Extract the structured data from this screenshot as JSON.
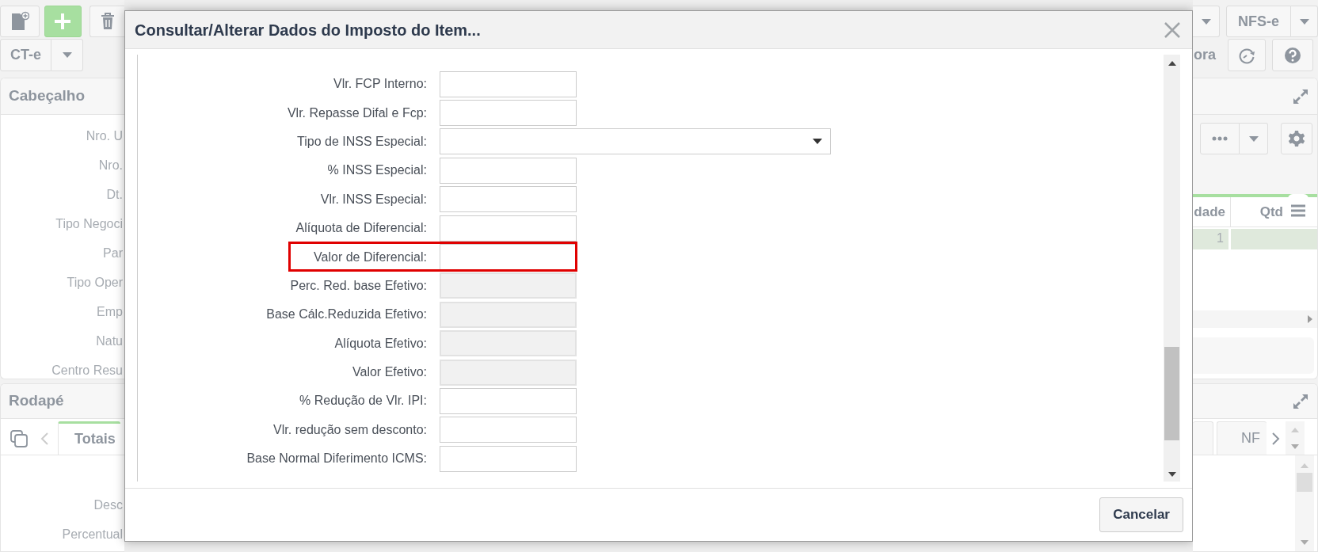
{
  "toolbar": {
    "ct_button": "CT-e",
    "nfse_button": "NFS-e",
    "partial_button": "ora"
  },
  "header_panel": {
    "title": "Cabeçalho",
    "labels": [
      "Nro. U",
      "Nro.",
      "Dt.",
      "Tipo Negoci",
      "Par",
      "Tipo Oper",
      "Emp",
      "Natu",
      "Centro Resu"
    ],
    "table": {
      "columns": [
        "dade",
        "Qtd"
      ],
      "rows": [
        {
          "cells": [
            "1"
          ],
          "selected": true
        }
      ]
    }
  },
  "footer_panel": {
    "title": "Rodapé",
    "tabs": [
      {
        "label": "Totais",
        "selected": true
      },
      {
        "label": "NF",
        "selected": false
      }
    ],
    "labels": [
      "Desc",
      "Percentual"
    ]
  },
  "dialog": {
    "title": "Consultar/Alterar Dados do Imposto do Item...",
    "fields": [
      {
        "label": "Vlr. FCP Interno:",
        "kind": "input",
        "disabled": false,
        "highlighted": false
      },
      {
        "label": "Vlr. Repasse Difal e Fcp:",
        "kind": "input",
        "disabled": false,
        "highlighted": false
      },
      {
        "label": "Tipo de INSS Especial:",
        "kind": "select",
        "disabled": false,
        "highlighted": false
      },
      {
        "label": "% INSS Especial:",
        "kind": "input",
        "disabled": false,
        "highlighted": false
      },
      {
        "label": "Vlr. INSS Especial:",
        "kind": "input",
        "disabled": false,
        "highlighted": false
      },
      {
        "label": "Alíquota de Diferencial:",
        "kind": "input",
        "disabled": false,
        "highlighted": false
      },
      {
        "label": "Valor de Diferencial:",
        "kind": "input",
        "disabled": false,
        "highlighted": true
      },
      {
        "label": "Perc. Red. base Efetivo:",
        "kind": "input",
        "disabled": true,
        "highlighted": false
      },
      {
        "label": "Base Cálc.Reduzida Efetivo:",
        "kind": "input",
        "disabled": true,
        "highlighted": false
      },
      {
        "label": "Alíquota Efetivo:",
        "kind": "input",
        "disabled": true,
        "highlighted": false
      },
      {
        "label": "Valor Efetivo:",
        "kind": "input",
        "disabled": true,
        "highlighted": false
      },
      {
        "label": "% Redução de Vlr. IPI:",
        "kind": "input",
        "disabled": false,
        "highlighted": false
      },
      {
        "label": "Vlr. redução sem desconto:",
        "kind": "input",
        "disabled": false,
        "highlighted": false
      },
      {
        "label": "Base Normal Diferimento ICMS:",
        "kind": "input",
        "disabled": false,
        "highlighted": false
      }
    ],
    "buttons": [
      "Cancelar"
    ]
  }
}
